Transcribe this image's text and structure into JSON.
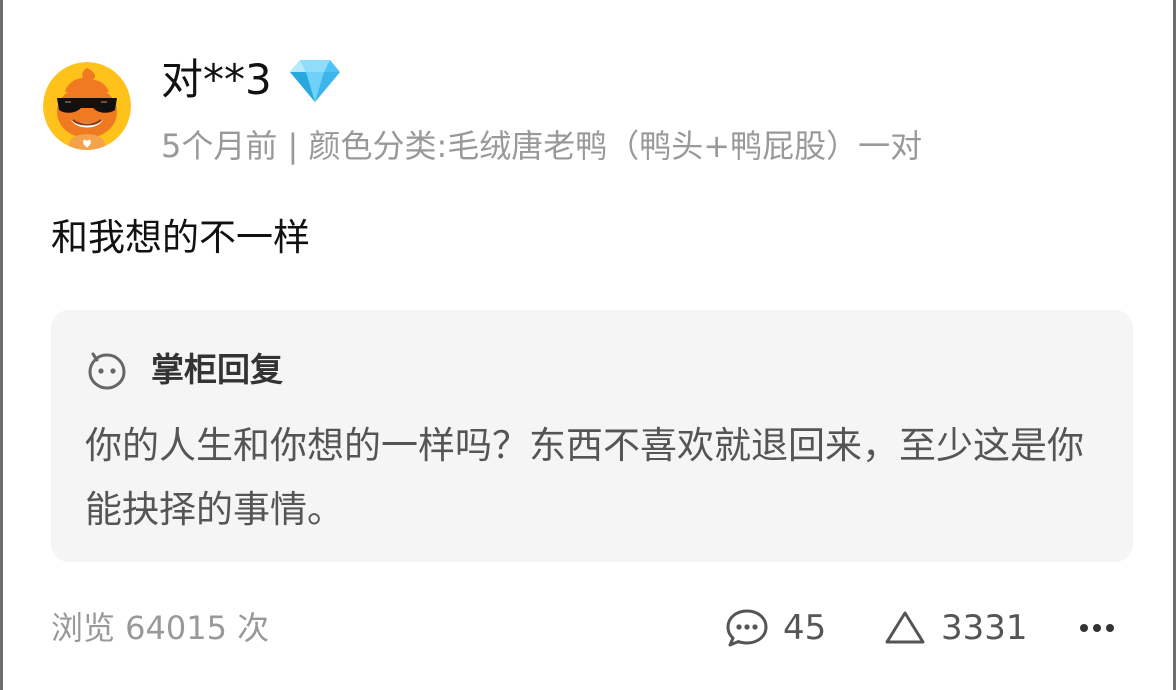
{
  "review": {
    "user": {
      "name": "对**3",
      "badge_icon": "diamond-icon",
      "avatar_icon": "duck-mascot-avatar"
    },
    "meta": "5个月前 | 颜色分类:毛绒唐老鸭（鸭头+鸭屁股）一对",
    "text": "和我想的不一样",
    "reply": {
      "icon": "smile-icon",
      "title": "掌柜回复",
      "text": "你的人生和你想的一样吗？东西不喜欢就退回来，至少这是你能抉择的事情。"
    },
    "footer": {
      "views": "浏览 64015 次",
      "comment_count": "45",
      "like_count": "3331",
      "comment_icon": "comment-bubble-icon",
      "like_icon": "thumb-up-icon",
      "more_icon": "more-dots-icon"
    }
  },
  "colors": {
    "diamond": "#4fc3f7",
    "avatar_bg": "#ffc21a",
    "avatar_duck": "#f07a22",
    "reply_bg": "#f5f5f5",
    "muted_text": "#999999"
  }
}
